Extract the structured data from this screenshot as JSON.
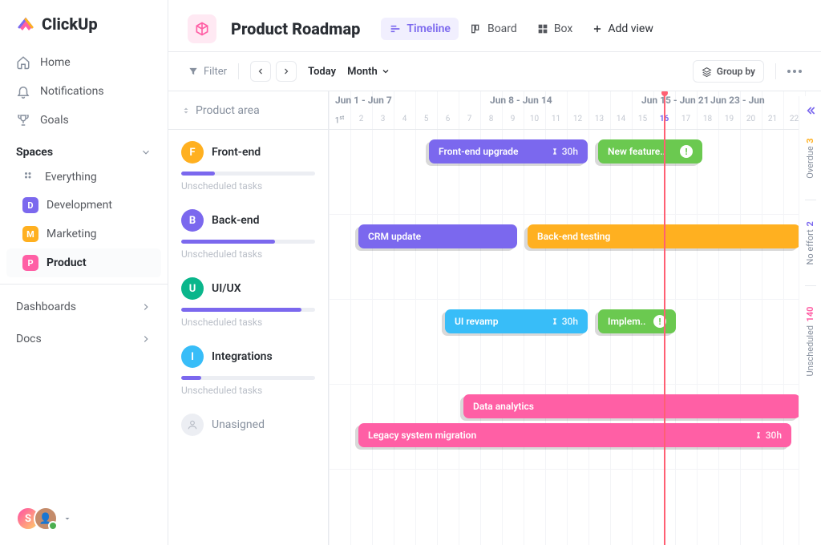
{
  "brand": "ClickUp",
  "nav": {
    "home": "Home",
    "notifications": "Notifications",
    "goals": "Goals"
  },
  "sidebar": {
    "spaces_label": "Spaces",
    "everything": "Everything",
    "items": [
      {
        "letter": "D",
        "label": "Development",
        "color": "#7b68ee"
      },
      {
        "letter": "M",
        "label": "Marketing",
        "color": "#ffb020"
      },
      {
        "letter": "P",
        "label": "Product",
        "color": "#ff5fa5"
      }
    ],
    "dashboards": "Dashboards",
    "docs": "Docs"
  },
  "header": {
    "title": "Product Roadmap",
    "tabs": {
      "timeline": "Timeline",
      "board": "Board",
      "box": "Box",
      "add": "Add view"
    }
  },
  "toolbar": {
    "filter": "Filter",
    "today": "Today",
    "granularity": "Month",
    "groupby": "Group by"
  },
  "timeline": {
    "group_header": "Product area",
    "unscheduled": "Unscheduled tasks",
    "weeks": [
      {
        "label": "Jun 1 - Jun 7"
      },
      {
        "label": "Jun 8 - Jun 14"
      },
      {
        "label": "Jun 15 - Jun 21"
      },
      {
        "label": "Jun 23 - Jun"
      }
    ],
    "first_day_label": "1st",
    "active_day": "16",
    "groups": [
      {
        "letter": "F",
        "name": "Front-end",
        "color": "#ffb020",
        "progress": 25,
        "tasks": [
          {
            "label": "Front-end upgrade",
            "color": "#7b68ee",
            "effort": "30h"
          },
          {
            "label": "New feature..",
            "color": "#6bc950",
            "alert": true
          }
        ]
      },
      {
        "letter": "B",
        "name": "Back-end",
        "color": "#7b68ee",
        "progress": 70,
        "tasks": [
          {
            "label": "CRM update",
            "color": "#7b68ee"
          },
          {
            "label": "Back-end testing",
            "color": "#ffb020"
          }
        ]
      },
      {
        "letter": "U",
        "name": "UI/UX",
        "color": "#0ab68b",
        "progress": 90,
        "tasks": [
          {
            "label": "UI revamp",
            "color": "#38bdf8",
            "effort": "30h"
          },
          {
            "label": "Implem..",
            "color": "#6bc950",
            "alert": true
          }
        ]
      },
      {
        "letter": "I",
        "name": "Integrations",
        "color": "#38bdf8",
        "progress": 15,
        "tasks": [
          {
            "label": "Data analytics",
            "color": "#ff5fa5"
          },
          {
            "label": "Legacy system migration",
            "color": "#ff5fa5",
            "effort": "30h"
          }
        ]
      },
      {
        "letter": "",
        "name": "Unasigned",
        "color": "#eceef3"
      }
    ]
  },
  "rail": {
    "overdue": {
      "count": "3",
      "label": "Overdue",
      "color": "#ffb020"
    },
    "noeffort": {
      "count": "2",
      "label": "No effort",
      "color": "#7b68ee"
    },
    "unscheduled": {
      "count": "140",
      "label": "Unscheduled",
      "color": "#ff5fa5"
    }
  }
}
